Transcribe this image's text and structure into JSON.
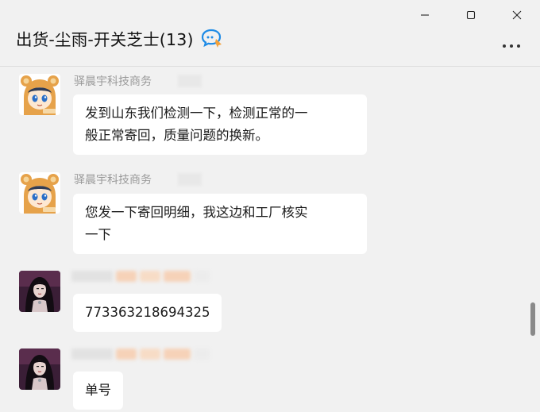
{
  "header": {
    "title": "出货-尘雨-开关芝士(13)"
  },
  "messages": [
    {
      "sender": "驿晨宇科技商务",
      "text_lines": [
        "发到山东我们检测一下，检测正常的一",
        "般正常寄回，质量问题的换新。"
      ]
    },
    {
      "sender": "驿晨宇科技商务",
      "text_lines": [
        "您发一下寄回明细，我这边和工厂核实",
        "一下"
      ]
    },
    {
      "sender": "",
      "text_lines": [
        "773363218694325"
      ]
    },
    {
      "sender": "",
      "text_lines": [
        "单号"
      ]
    }
  ],
  "colors": {
    "background": "#f1f1f1",
    "bubble": "#ffffff",
    "accent_blue": "#1e8be6",
    "accent_orange": "#f3a13b"
  },
  "icons": {
    "group_chat": "chat-bubbles-icon",
    "minimize": "minimize-icon",
    "maximize": "maximize-icon",
    "close": "close-icon",
    "more": "more-icon"
  }
}
